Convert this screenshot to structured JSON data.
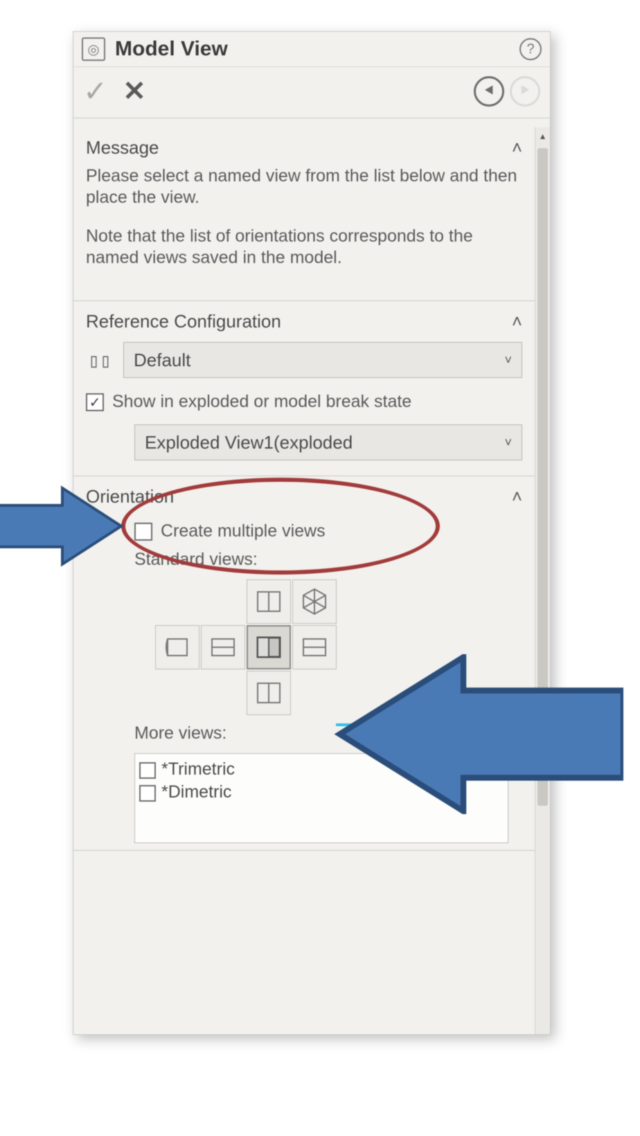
{
  "panel": {
    "title": "Model View"
  },
  "message": {
    "header": "Message",
    "p1": "Please select a named view from the list below and then place the view.",
    "p2": "Note that the list of orientations corresponds to the named views saved in the model."
  },
  "refconfig": {
    "header": "Reference Configuration",
    "selected": "Default",
    "show_exploded_label": "Show in exploded or model break state",
    "show_exploded_checked": true,
    "exploded_view_selected": "Exploded View1(exploded"
  },
  "orientation": {
    "header": "Orientation",
    "create_multiple_label": "Create multiple views",
    "create_multiple_checked": false,
    "standard_views_label": "Standard views:",
    "more_views_label": "More views:",
    "more_views": [
      {
        "label": "*Trimetric",
        "checked": false
      },
      {
        "label": "*Dimetric",
        "checked": false
      }
    ]
  }
}
